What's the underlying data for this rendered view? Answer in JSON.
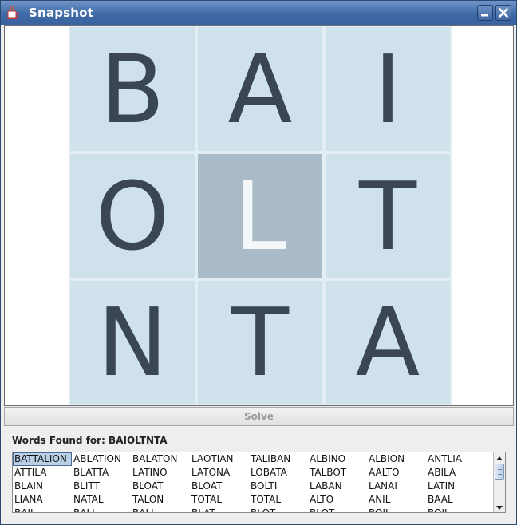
{
  "window": {
    "title": "Snapshot",
    "icon": "java-cup-icon"
  },
  "board": {
    "rows": [
      [
        "B",
        "A",
        "I"
      ],
      [
        "O",
        "L",
        "T"
      ],
      [
        "N",
        "T",
        "A"
      ]
    ],
    "highlighted_cell": "L"
  },
  "solve_button": {
    "label": "Solve"
  },
  "words_found": {
    "label": "Words Found for: BAIOLTNTA",
    "selected": "BATTALION",
    "rows": [
      [
        "BATTALION",
        "ABLATION",
        "BALATON",
        "LAOTIAN",
        "TALIBAN",
        "ALBINO",
        "ALBION",
        "ANTLIA"
      ],
      [
        "ATTILA",
        "BLATTA",
        "LATINO",
        "LATONA",
        "LOBATA",
        "TALBOT",
        "AALTO",
        "ABILA"
      ],
      [
        "BLAIN",
        "BLITT",
        "BLOAT",
        "BLOAT",
        "BOLTI",
        "LABAN",
        "LANAI",
        "LATIN"
      ],
      [
        "LIANA",
        "NATAL",
        "TALON",
        "TOTAL",
        "TOTAL",
        "ALTO",
        "ANIL",
        "BAAL"
      ],
      [
        "BAIL",
        "BALI",
        "BALL",
        "BLAT",
        "BLOT",
        "BLOT",
        "BOIL",
        "BOIL"
      ]
    ]
  },
  "colors": {
    "titlebar": "#3f6aa6",
    "board_tile": "#cfe2ec",
    "highlight_tile": "#a8bbc6",
    "letter": "#3a4654"
  }
}
